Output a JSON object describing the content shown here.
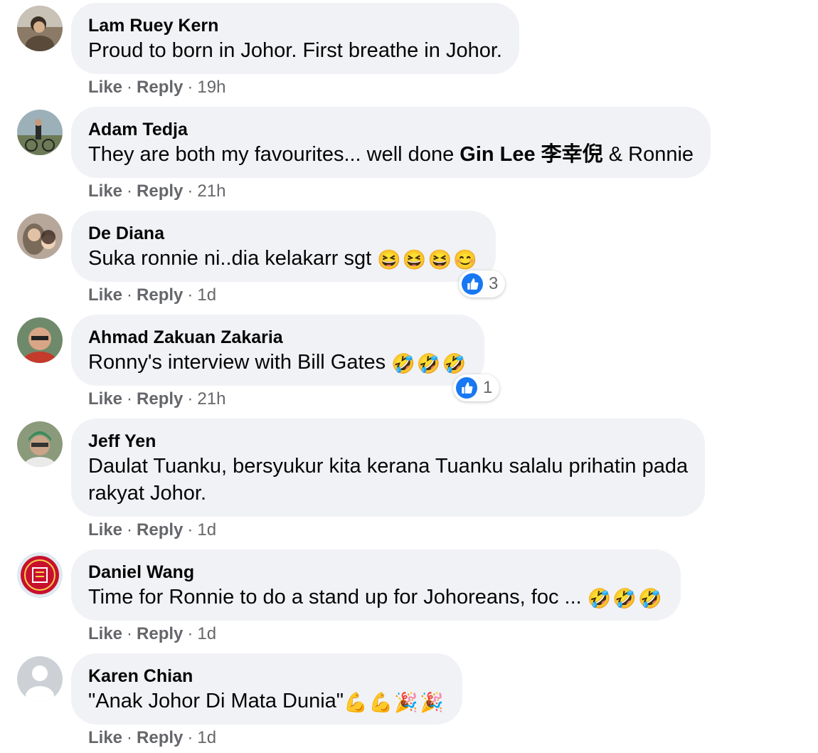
{
  "colors": {
    "bubble": "#f0f2f5",
    "meta": "#65676b",
    "like_blue": "#1877f2"
  },
  "comments": [
    {
      "author": "Lam Ruey Kern",
      "text": "Proud to born in Johor. First breathe in Johor.",
      "like": "Like",
      "reply": "Reply",
      "time": "19h"
    },
    {
      "author": "Adam Tedja",
      "text_before": "They are both my favourites... well done ",
      "mention": "Gin Lee 李幸倪",
      "text_after": " & Ronnie",
      "like": "Like",
      "reply": "Reply",
      "time": "21h"
    },
    {
      "author": "De Diana",
      "text": "Suka ronnie ni..dia kelakarr sgt",
      "emoji": "😆😆😆😊",
      "like": "Like",
      "reply": "Reply",
      "time": "1d",
      "reaction_icon": "thumbs-up-icon",
      "reaction_count": "3"
    },
    {
      "author": "Ahmad Zakuan Zakaria",
      "text": "Ronny's interview with Bill Gates",
      "emoji": "🤣🤣🤣",
      "like": "Like",
      "reply": "Reply",
      "time": "21h",
      "reaction_icon": "thumbs-up-icon",
      "reaction_count": "1"
    },
    {
      "author": "Jeff Yen",
      "text_line1": "Daulat Tuanku, bersyukur kita kerana Tuanku salalu prihatin pada",
      "text_line2": "rakyat Johor.",
      "like": "Like",
      "reply": "Reply",
      "time": "1d"
    },
    {
      "author": "Daniel Wang",
      "text": "Time for Ronnie to do a stand up for Johoreans, foc ...",
      "emoji": "🤣🤣🤣",
      "like": "Like",
      "reply": "Reply",
      "time": "1d"
    },
    {
      "author": "Karen Chian",
      "text": "\"Anak Johor Di Mata Dunia\"",
      "emoji": "💪💪🎉🎉",
      "like": "Like",
      "reply": "Reply",
      "time": "1d"
    }
  ]
}
